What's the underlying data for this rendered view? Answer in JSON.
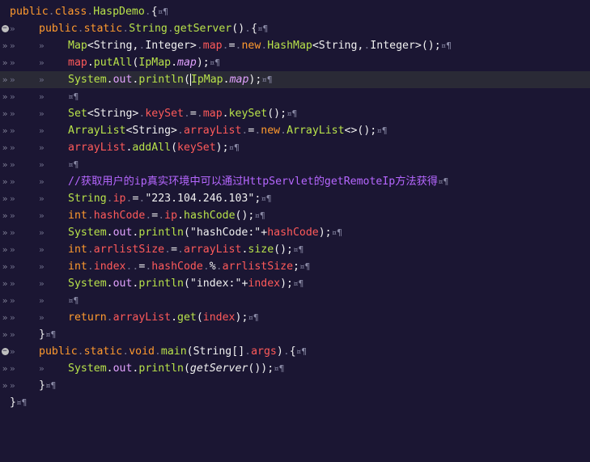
{
  "editor": {
    "file_class": "HaspDemo",
    "lines": [
      {
        "gutter": "",
        "code": "public.class.HaspDemo.{¤¶"
      },
      {
        "gutter": "fold",
        "code": "»   public.static.String.getServer().{¤¶"
      },
      {
        "gutter": "»",
        "code": "»   »   Map<String,.Integer>.map.=.new.HashMap<String,.Integer>();¤¶"
      },
      {
        "gutter": "»",
        "code": "»   »   map.putAll(IpMap.map);¤¶"
      },
      {
        "gutter": "»",
        "code": "»   »   System.out.println(IpMap.map);¤¶",
        "highlight": true
      },
      {
        "gutter": "»",
        "code": "»   »   ¤¶"
      },
      {
        "gutter": "»",
        "code": "»   »   Set<String>.keySet.=.map.keySet();¤¶"
      },
      {
        "gutter": "»",
        "code": "»   »   ArrayList<String>.arrayList.=.new.ArrayList<>();¤¶"
      },
      {
        "gutter": "»",
        "code": "»   »   arrayList.addAll(keySet);¤¶"
      },
      {
        "gutter": "»",
        "code": "»   »   ¤¶"
      },
      {
        "gutter": "»",
        "code": "»   »   //获取用户的ip真实环境中可以通过HttpServlet的getRemoteIp方法获得¤¶"
      },
      {
        "gutter": "»",
        "code": "»   »   String.ip.=.\"223.104.246.103\";¤¶"
      },
      {
        "gutter": "»",
        "code": "»   »   int.hashCode.=.ip.hashCode();¤¶"
      },
      {
        "gutter": "»",
        "code": "»   »   System.out.println(\"hashCode:\"+hashCode);¤¶"
      },
      {
        "gutter": "»",
        "code": "»   »   int.arrlistSize.=.arrayList.size();¤¶"
      },
      {
        "gutter": "»",
        "code": "»   »   int.index..=.hashCode.%.arrlistSize;¤¶"
      },
      {
        "gutter": "»",
        "code": "»   »   System.out.println(\"index:\"+index);¤¶"
      },
      {
        "gutter": "»",
        "code": "»   »   ¤¶"
      },
      {
        "gutter": "»",
        "code": "»   »   return.arrayList.get(index);¤¶"
      },
      {
        "gutter": "»",
        "code": "»   }¤¶"
      },
      {
        "gutter": "fold",
        "code": "»   public.static.void.main(String[].args).{¤¶"
      },
      {
        "gutter": "»",
        "code": "»   »   System.out.println(getServer());¤¶"
      },
      {
        "gutter": "»",
        "code": "»   }¤¶"
      },
      {
        "gutter": "",
        "code": "}¤¶"
      }
    ]
  }
}
